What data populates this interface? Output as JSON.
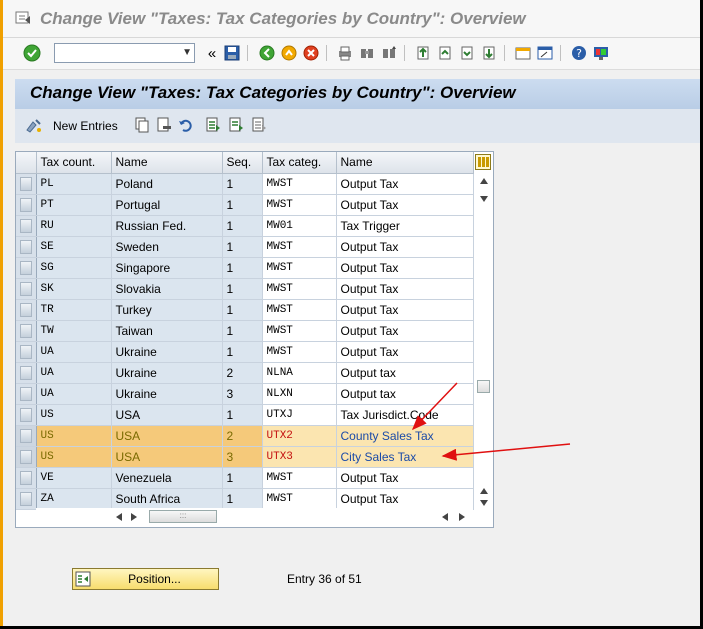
{
  "window": {
    "title": "Change View \"Taxes: Tax Categories by Country\": Overview"
  },
  "toolbar": {
    "command_field_value": "",
    "icons": [
      "enter-icon",
      "back-arrows-icon",
      "save-icon",
      "back-icon",
      "exit-icon",
      "cancel-icon",
      "print-icon",
      "find-icon",
      "find-next-icon",
      "first-page-icon",
      "previous-page-icon",
      "next-page-icon",
      "last-page-icon",
      "create-session-icon",
      "shortcut-icon",
      "help-icon",
      "customize-layout-icon"
    ],
    "double_arrow": "«"
  },
  "header": {
    "title": "Change View \"Taxes: Tax Categories by Country\": Overview"
  },
  "app_toolbar": {
    "new_entries_label": "New Entries",
    "icons": [
      "copy-as-icon",
      "delete-icon",
      "undo-change-icon",
      "select-all-icon",
      "select-block-icon",
      "deselect-all-icon"
    ]
  },
  "table": {
    "columns": [
      "Tax count.",
      "Name",
      "Seq.",
      "Tax categ.",
      "Name"
    ],
    "rows": [
      {
        "country": "PL",
        "name": "Poland",
        "seq": "1",
        "categ": "MWST",
        "tax_name": "Output Tax",
        "highlight": false
      },
      {
        "country": "PT",
        "name": "Portugal",
        "seq": "1",
        "categ": "MWST",
        "tax_name": "Output Tax",
        "highlight": false
      },
      {
        "country": "RU",
        "name": "Russian Fed.",
        "seq": "1",
        "categ": "MW01",
        "tax_name": "Tax Trigger",
        "highlight": false
      },
      {
        "country": "SE",
        "name": "Sweden",
        "seq": "1",
        "categ": "MWST",
        "tax_name": "Output Tax",
        "highlight": false
      },
      {
        "country": "SG",
        "name": "Singapore",
        "seq": "1",
        "categ": "MWST",
        "tax_name": "Output Tax",
        "highlight": false
      },
      {
        "country": "SK",
        "name": "Slovakia",
        "seq": "1",
        "categ": "MWST",
        "tax_name": "Output Tax",
        "highlight": false
      },
      {
        "country": "TR",
        "name": "Turkey",
        "seq": "1",
        "categ": "MWST",
        "tax_name": "Output Tax",
        "highlight": false
      },
      {
        "country": "TW",
        "name": "Taiwan",
        "seq": "1",
        "categ": "MWST",
        "tax_name": "Output Tax",
        "highlight": false
      },
      {
        "country": "UA",
        "name": "Ukraine",
        "seq": "1",
        "categ": "MWST",
        "tax_name": "Output Tax",
        "highlight": false
      },
      {
        "country": "UA",
        "name": "Ukraine",
        "seq": "2",
        "categ": "NLNA",
        "tax_name": "Output tax",
        "highlight": false
      },
      {
        "country": "UA",
        "name": "Ukraine",
        "seq": "3",
        "categ": "NLXN",
        "tax_name": "Output tax",
        "highlight": false
      },
      {
        "country": "US",
        "name": "USA",
        "seq": "1",
        "categ": "UTXJ",
        "tax_name": "Tax Jurisdict.Code",
        "highlight": false
      },
      {
        "country": "US",
        "name": "USA",
        "seq": "2",
        "categ": "UTX2",
        "tax_name": "County Sales Tax",
        "highlight": true
      },
      {
        "country": "US",
        "name": "USA",
        "seq": "3",
        "categ": "UTX3",
        "tax_name": "City Sales Tax",
        "highlight": true
      },
      {
        "country": "VE",
        "name": "Venezuela",
        "seq": "1",
        "categ": "MWST",
        "tax_name": "Output Tax",
        "highlight": false
      },
      {
        "country": "ZA",
        "name": "South Africa",
        "seq": "1",
        "categ": "MWST",
        "tax_name": "Output Tax",
        "highlight": false
      }
    ]
  },
  "footer": {
    "position_label": "Position...",
    "entry_info": "Entry 36 of 51"
  },
  "colors": {
    "highlight_row": "#f5c97a",
    "highlight_code": "#c41010",
    "annotation_arrow": "#e01010"
  }
}
